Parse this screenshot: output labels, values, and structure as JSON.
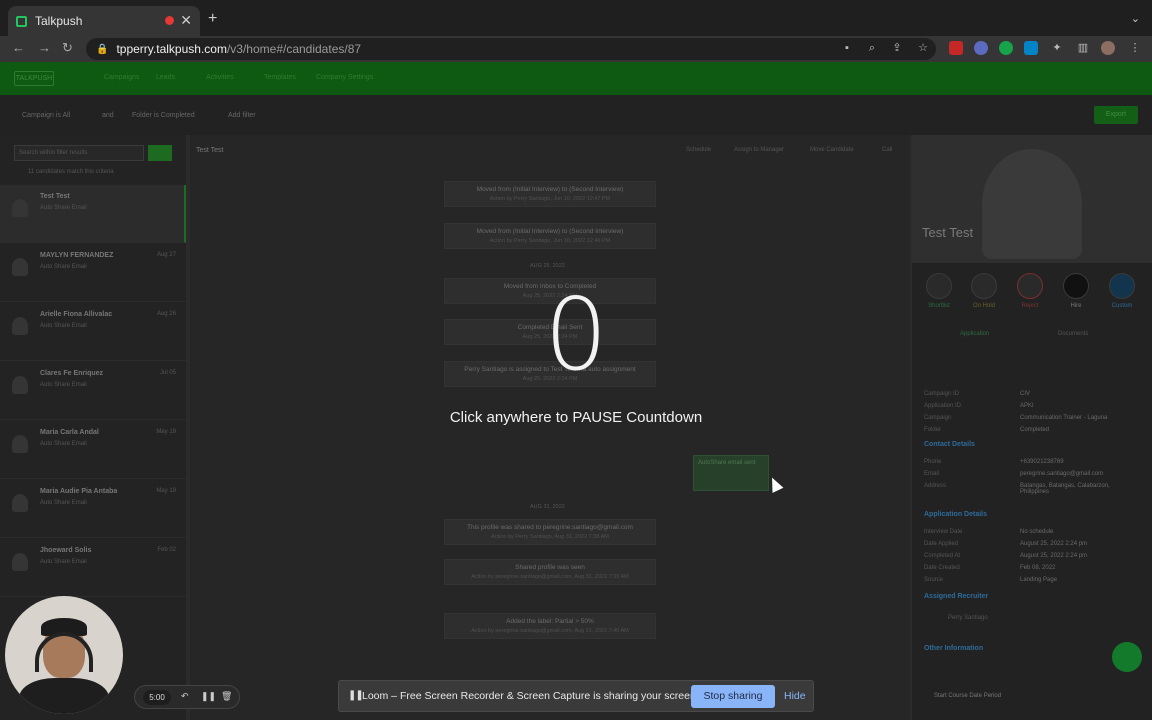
{
  "browser": {
    "tab_title": "Talkpush",
    "url_host": "tpperry.talkpush.com",
    "url_path": "/v3/home#/candidates/87"
  },
  "app": {
    "logo": "TALKPUSH",
    "nav": [
      "Campaigns",
      "Leads",
      "Activities",
      "Templates",
      "Company Settings"
    ],
    "filters": [
      "Campaign is All",
      "and",
      "Folder is Completed",
      "Add filter"
    ],
    "export_label": "Export",
    "search_placeholder": "Search within filter results",
    "matches": "11 candidates match this criteria",
    "candidates": [
      {
        "name": "Test Test",
        "sub": "Auto Share Email",
        "date": ""
      },
      {
        "name": "MAYLYN FERNANDEZ",
        "sub": "Auto Share Email",
        "date": "Aug 27"
      },
      {
        "name": "Arielle Fiona Allivalac",
        "sub": "Auto Share Email",
        "date": "Aug 26"
      },
      {
        "name": "Clares Fe Enriquez",
        "sub": "Auto Share Email",
        "date": "Jul 05"
      },
      {
        "name": "Maria Carla Andal",
        "sub": "Auto Share Email",
        "date": "May 19"
      },
      {
        "name": "Maria Audie Pia Antaba",
        "sub": "Auto Share Email",
        "date": "May 19"
      },
      {
        "name": "Jhoeward Solis",
        "sub": "Auto Share Email",
        "date": "Feb 02"
      }
    ],
    "conversation_title": "Test Test",
    "conversation_actions": [
      "Schedule",
      "Assign to Manager",
      "Move Candidate",
      "Call"
    ],
    "events": [
      {
        "title": "Moved from (Initial Interview) to (Second Interview)",
        "sub": "Action by Perry Santiago, Jun 10, 2022 12:47 PM"
      },
      {
        "title": "Moved from (Initial Interview) to (Second Interview)",
        "sub": "Action by Perry Santiago, Jun 10, 2022 12:49 PM"
      },
      {
        "title": "Moved from Inbox to Completed",
        "sub": "Aug 25, 2022 2:24 PM"
      },
      {
        "title": "Completed Email Sent",
        "sub": "Aug 25, 2022 2:24 PM"
      },
      {
        "title": "Perry Santiago is assigned to Test Test via auto assignment",
        "sub": "Aug 25, 2022 2:24 PM"
      },
      {
        "title": "This profile was shared to peregrine.santiago@gmail.com",
        "sub": "Action by Perry Santiago, Aug 31, 2022 7:38 AM"
      },
      {
        "title": "Shared profile was seen",
        "sub": "Action by peregrine.santiago@gmail.com, Aug 31, 2022 7:39 AM"
      },
      {
        "title": "Added the label: Partial > 50%",
        "sub": "Action by peregrine.santiago@gmail.com, Aug 31, 2022 7:40 AM"
      }
    ],
    "date_separators": [
      "AUG 25, 2022",
      "AUG 31, 2022"
    ],
    "bubble_text": "AutoShare email sent",
    "profile": {
      "name": "Test Test",
      "actions": [
        "Shortlist",
        "On Hold",
        "Reject",
        "Hire",
        "Custom"
      ],
      "tabs": [
        "Application",
        "Documents"
      ],
      "fields": [
        {
          "label": "Campaign ID",
          "value": "CIV"
        },
        {
          "label": "Application ID",
          "value": "APKI"
        },
        {
          "label": "Campaign",
          "value": "Communication Trainer - Laguna"
        },
        {
          "label": "Folder",
          "value": "Completed"
        }
      ],
      "contact_title": "Contact Details",
      "contact": [
        {
          "label": "Phone",
          "value": "+639021238769"
        },
        {
          "label": "Email",
          "value": "peregrine.santiago@gmail.com"
        },
        {
          "label": "Address",
          "value": "Batangas, Batangas, Calabarzon, Philippines"
        }
      ],
      "app_title": "Application Details",
      "app_details": [
        {
          "label": "Interview Date",
          "value": "No schedule"
        },
        {
          "label": "Date Applied",
          "value": "August 25, 2022 2:24 pm"
        },
        {
          "label": "Completed At",
          "value": "August 25, 2022 2:24 pm"
        },
        {
          "label": "Date Created",
          "value": "Feb 08, 2022"
        },
        {
          "label": "Source",
          "value": "Landing Page"
        }
      ],
      "recruiter_title": "Assigned Recruiter",
      "recruiter": "Perry Santiago",
      "other_title": "Other Information",
      "course_label": "Start Course Date Period"
    }
  },
  "overlay": {
    "countdown": "0",
    "pause_message": "Click anywhere to PAUSE Countdown"
  },
  "recorder": {
    "time": "5:00"
  },
  "loom": {
    "message": "Loom – Free Screen Recorder & Screen Capture is sharing your screen.",
    "stop_label": "Stop sharing",
    "hide_label": "Hide"
  }
}
